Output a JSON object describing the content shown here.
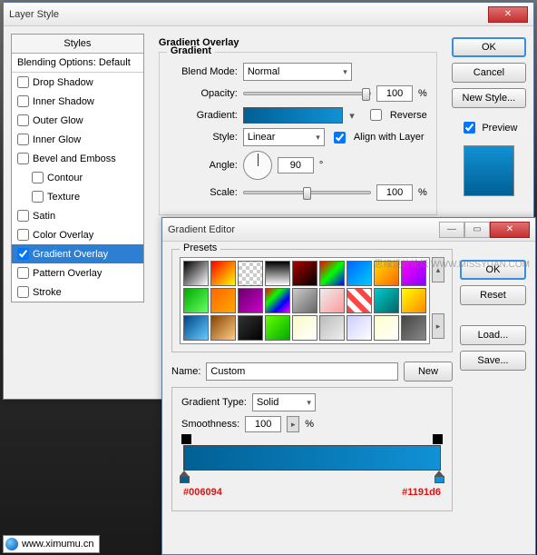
{
  "layerStyle": {
    "title": "Layer Style",
    "stylesHeader": "Styles",
    "blendingOptions": "Blending Options: Default",
    "items": [
      {
        "label": "Drop Shadow",
        "checked": false
      },
      {
        "label": "Inner Shadow",
        "checked": false
      },
      {
        "label": "Outer Glow",
        "checked": false
      },
      {
        "label": "Inner Glow",
        "checked": false
      },
      {
        "label": "Bevel and Emboss",
        "checked": false
      },
      {
        "label": "Contour",
        "checked": false,
        "sub": true
      },
      {
        "label": "Texture",
        "checked": false,
        "sub": true
      },
      {
        "label": "Satin",
        "checked": false
      },
      {
        "label": "Color Overlay",
        "checked": false
      },
      {
        "label": "Gradient Overlay",
        "checked": true,
        "selected": true
      },
      {
        "label": "Pattern Overlay",
        "checked": false
      },
      {
        "label": "Stroke",
        "checked": false
      }
    ],
    "section": {
      "title": "Gradient Overlay",
      "group": "Gradient",
      "blendModeLabel": "Blend Mode:",
      "blendMode": "Normal",
      "opacityLabel": "Opacity:",
      "opacity": "100",
      "opacityUnit": "%",
      "gradientLabel": "Gradient:",
      "reverseLabel": "Reverse",
      "styleLabel": "Style:",
      "style": "Linear",
      "alignLabel": "Align with Layer",
      "alignChecked": true,
      "angleLabel": "Angle:",
      "angle": "90",
      "angleUnit": "°",
      "scaleLabel": "Scale:",
      "scale": "100",
      "scaleUnit": "%"
    },
    "buttons": {
      "ok": "OK",
      "cancel": "Cancel",
      "newStyle": "New Style...",
      "previewLabel": "Preview",
      "previewChecked": true
    }
  },
  "gradientEditor": {
    "title": "Gradient Editor",
    "presetsLabel": "Presets",
    "presets": [
      [
        "linear-gradient(135deg,#000,#fff)",
        "linear-gradient(135deg,#f00,#ff0)",
        "repeating-conic-gradient(#ccc 0 25%,#fff 0 50%) 0/8px 8px",
        "linear-gradient(#000,#fff)",
        "linear-gradient(135deg,#a00,#000)",
        "linear-gradient(135deg,#f00,#0f0,#00f)",
        "linear-gradient(135deg,#06f,#0cf)",
        "linear-gradient(135deg,#fd0,#f60)",
        "linear-gradient(135deg,#f0f,#80f)"
      ],
      [
        "linear-gradient(135deg,#0a0,#6f6)",
        "linear-gradient(135deg,#f60,#fa0)",
        "linear-gradient(135deg,#606,#c0c)",
        "linear-gradient(135deg,#f00,#0f0,#00f,#f0f)",
        "linear-gradient(135deg,#ccc,#666)",
        "linear-gradient(135deg,#eee,#f99)",
        "repeating-linear-gradient(45deg,#f44 0 6px,#fff 6px 12px)",
        "linear-gradient(135deg,#0cc,#066)",
        "linear-gradient(135deg,#ff0,#f80)"
      ],
      [
        "linear-gradient(135deg,#048,#6cf)",
        "linear-gradient(135deg,#840,#fc8)",
        "linear-gradient(135deg,#333,#000)",
        "linear-gradient(135deg,#6f0,#0a0)",
        "linear-gradient(135deg,#fafac8,#fff)",
        "linear-gradient(135deg,#bbb,#eee)",
        "linear-gradient(135deg,#ccf,#fff)",
        "linear-gradient(135deg,#ffc,#fff)",
        "linear-gradient(135deg,#444,#888)"
      ]
    ],
    "nameLabel": "Name:",
    "nameValue": "Custom",
    "newBtn": "New",
    "gradTypeLabel": "Gradient Type:",
    "gradType": "Solid",
    "smoothLabel": "Smoothness:",
    "smooth": "100",
    "smoothUnit": "%",
    "stopLeft": "#006094",
    "stopRight": "#1191d6",
    "buttons": {
      "ok": "OK",
      "reset": "Reset",
      "load": "Load...",
      "save": "Save..."
    }
  },
  "watermark": "思缘设计论坛  WWW.MISSYUAN.COM",
  "siteBadge": "www.ximumu.cn"
}
